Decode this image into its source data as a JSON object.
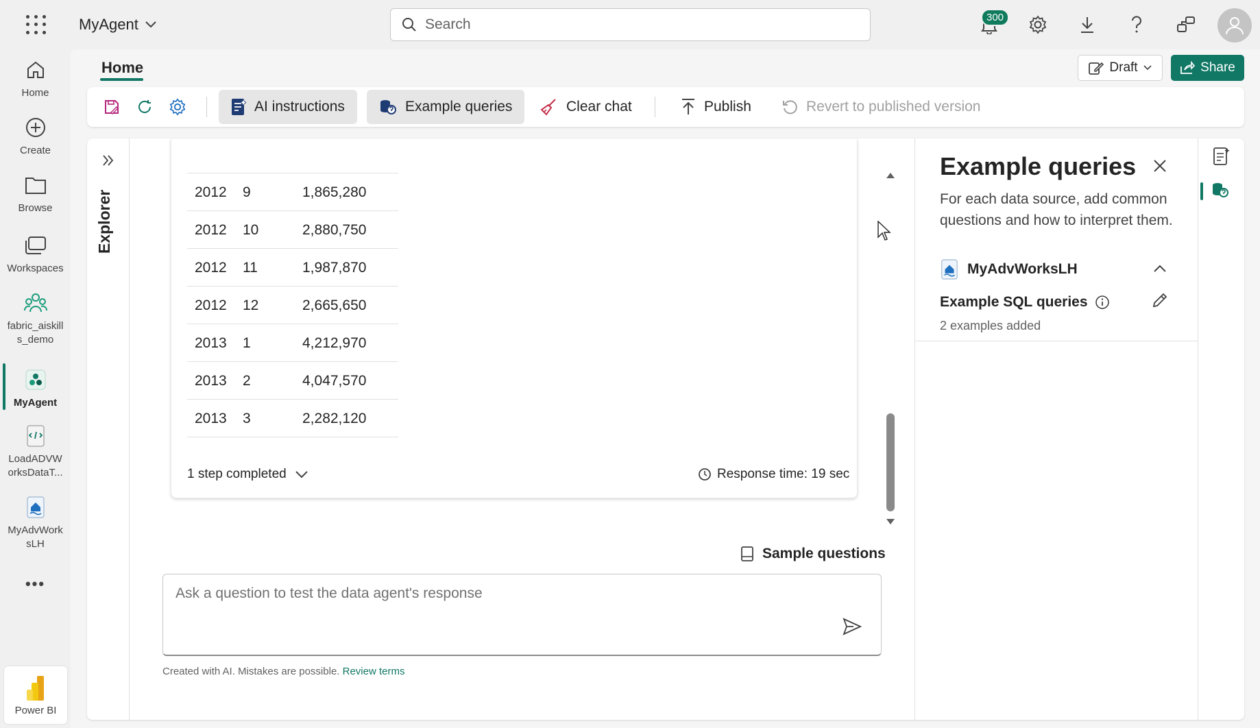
{
  "topbar": {
    "app_name": "MyAgent",
    "search_placeholder": "Search",
    "notification_count": "300",
    "icons": [
      "app-launcher-icon",
      "chevron-down-icon",
      "search-icon",
      "bell-icon",
      "gear-icon",
      "download-icon",
      "help-icon",
      "share-feedback-icon",
      "avatar-icon"
    ]
  },
  "leftnav": {
    "items": [
      {
        "label": "Home",
        "icon": "home-icon"
      },
      {
        "label": "Create",
        "icon": "create-icon"
      },
      {
        "label": "Browse",
        "icon": "folder-icon"
      },
      {
        "label": "Workspaces",
        "icon": "workspaces-icon"
      },
      {
        "label": "fabric_aiskill\ns_demo",
        "icon": "workspace-group-icon"
      },
      {
        "label": "MyAgent",
        "icon": "agent-icon"
      },
      {
        "label": "LoadADVW\norksDataT...",
        "icon": "notebook-icon"
      },
      {
        "label": "MyAdvWork\nsLH",
        "icon": "lakehouse-icon"
      }
    ],
    "more": "•••",
    "powerbi_label": "Power BI"
  },
  "header": {
    "tab_home": "Home",
    "draft_label": "Draft",
    "share_label": "Share"
  },
  "toolbar": {
    "ai_instructions": "AI instructions",
    "example_queries": "Example queries",
    "clear_chat": "Clear chat",
    "publish": "Publish",
    "revert": "Revert to published version"
  },
  "explorer": {
    "label": "Explorer"
  },
  "chat": {
    "rows": [
      {
        "year": "2012",
        "month": "9",
        "value": "1,865,280"
      },
      {
        "year": "2012",
        "month": "10",
        "value": "2,880,750"
      },
      {
        "year": "2012",
        "month": "11",
        "value": "1,987,870"
      },
      {
        "year": "2012",
        "month": "12",
        "value": "2,665,650"
      },
      {
        "year": "2013",
        "month": "1",
        "value": "4,212,970"
      },
      {
        "year": "2013",
        "month": "2",
        "value": "4,047,570"
      },
      {
        "year": "2013",
        "month": "3",
        "value": "2,282,120"
      }
    ],
    "steps_completed": "1 step completed",
    "response_time": "Response time: 19 sec",
    "sample_questions": "Sample questions",
    "ask_placeholder": "Ask a question to test the data agent's response",
    "disclaimer": "Created with AI. Mistakes are possible.",
    "review_terms": "Review terms"
  },
  "example_panel": {
    "title": "Example queries",
    "description": "For each data source, add common questions and how to interpret them.",
    "datasource_name": "MyAdvWorksLH",
    "sql_title": "Example SQL queries",
    "sql_count": "2 examples added"
  },
  "colors": {
    "accent": "#117865",
    "badge": "#0f7b5c"
  }
}
